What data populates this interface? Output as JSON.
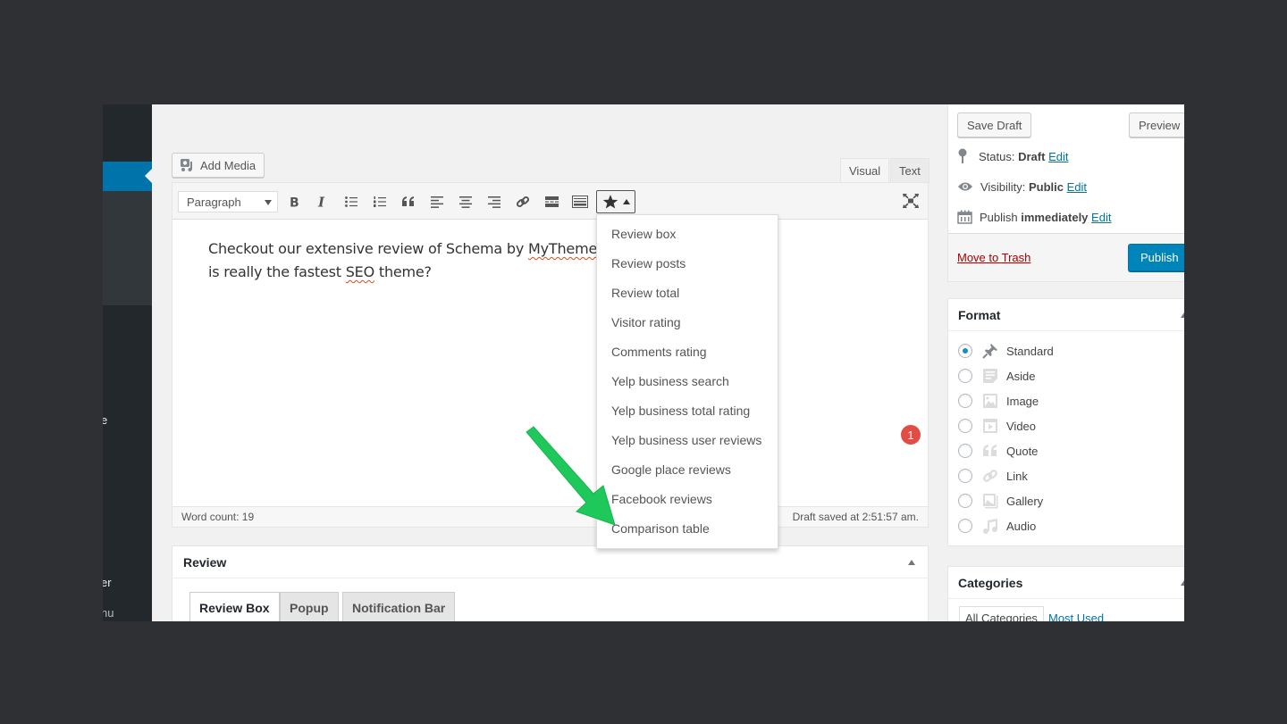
{
  "admin_menu": {
    "fragments": [
      {
        "text": "e",
        "dim": false
      },
      {
        "text": "er",
        "dim": false
      },
      {
        "text": "nu",
        "dim": true
      }
    ]
  },
  "editor": {
    "add_media_label": "Add Media",
    "tabs": {
      "visual": "Visual",
      "text": "Text"
    },
    "active_tab": "Visual",
    "format_select_value": "Paragraph",
    "toolbar_buttons": [
      {
        "name": "bold-button",
        "icon": "bold-icon"
      },
      {
        "name": "italic-button",
        "icon": "italic-icon"
      },
      {
        "name": "bulleted-list-button",
        "icon": "bulleted-list-icon"
      },
      {
        "name": "numbered-list-button",
        "icon": "numbered-list-icon"
      },
      {
        "name": "blockquote-button",
        "icon": "blockquote-icon"
      },
      {
        "name": "align-left-button",
        "icon": "align-left-icon"
      },
      {
        "name": "align-center-button",
        "icon": "align-center-icon"
      },
      {
        "name": "align-right-button",
        "icon": "align-right-icon"
      },
      {
        "name": "insert-link-button",
        "icon": "link-icon"
      },
      {
        "name": "read-more-button",
        "icon": "read-more-icon"
      },
      {
        "name": "toolbar-toggle-button",
        "icon": "keyboard-icon"
      }
    ],
    "shortcode_button_icon": "star-icon",
    "content": {
      "line1_before": "Checkout our extensive review of Schema by ",
      "line1_misspelled": "MyThemeSho",
      "line2_before": "is really the fastest ",
      "line2_misspelled": "SEO",
      "line2_after": " theme?"
    },
    "notification_badge": "1",
    "word_count": "Word count: 19",
    "draft_saved": "Draft saved at 2:51:57 am."
  },
  "shortcode_menu": {
    "items": [
      "Review box",
      "Review posts",
      "Review total",
      "Visitor rating",
      "Comments rating",
      "Yelp business search",
      "Yelp business total rating",
      "Yelp business user reviews",
      "Google place reviews",
      "Facebook reviews",
      "Comparison table"
    ],
    "highlighted": "Comparison table"
  },
  "review_box": {
    "title": "Review",
    "tabs": [
      "Review Box",
      "Popup",
      "Notification Bar"
    ],
    "active_tab": "Review Box"
  },
  "publish": {
    "save_draft": "Save Draft",
    "preview": "Preview",
    "status_label": "Status:",
    "status_value": "Draft",
    "visibility_label": "Visibility:",
    "visibility_value": "Public",
    "publish_label": "Publish",
    "publish_value": "immediately",
    "edit_link": "Edit",
    "move_to_trash": "Move to Trash",
    "publish_button": "Publish"
  },
  "format": {
    "title": "Format",
    "options": [
      {
        "label": "Standard",
        "icon": "pushpin-icon",
        "selected": true
      },
      {
        "label": "Aside",
        "icon": "aside-icon",
        "selected": false
      },
      {
        "label": "Image",
        "icon": "image-icon",
        "selected": false
      },
      {
        "label": "Video",
        "icon": "video-icon",
        "selected": false
      },
      {
        "label": "Quote",
        "icon": "quote-icon",
        "selected": false
      },
      {
        "label": "Link",
        "icon": "link-icon",
        "selected": false
      },
      {
        "label": "Gallery",
        "icon": "gallery-icon",
        "selected": false
      },
      {
        "label": "Audio",
        "icon": "audio-icon",
        "selected": false
      }
    ]
  },
  "categories": {
    "title": "Categories",
    "tabs": [
      "All Categories",
      "Most Used"
    ]
  },
  "colors": {
    "accent": "#0073aa",
    "publish_button": "#0085ba",
    "trash_link": "#a00000",
    "badge": "#e14d43",
    "annotation_arrow": "#1ec85a",
    "admin_menu_bg": "#23282d",
    "frame_bg": "#2f3034"
  }
}
